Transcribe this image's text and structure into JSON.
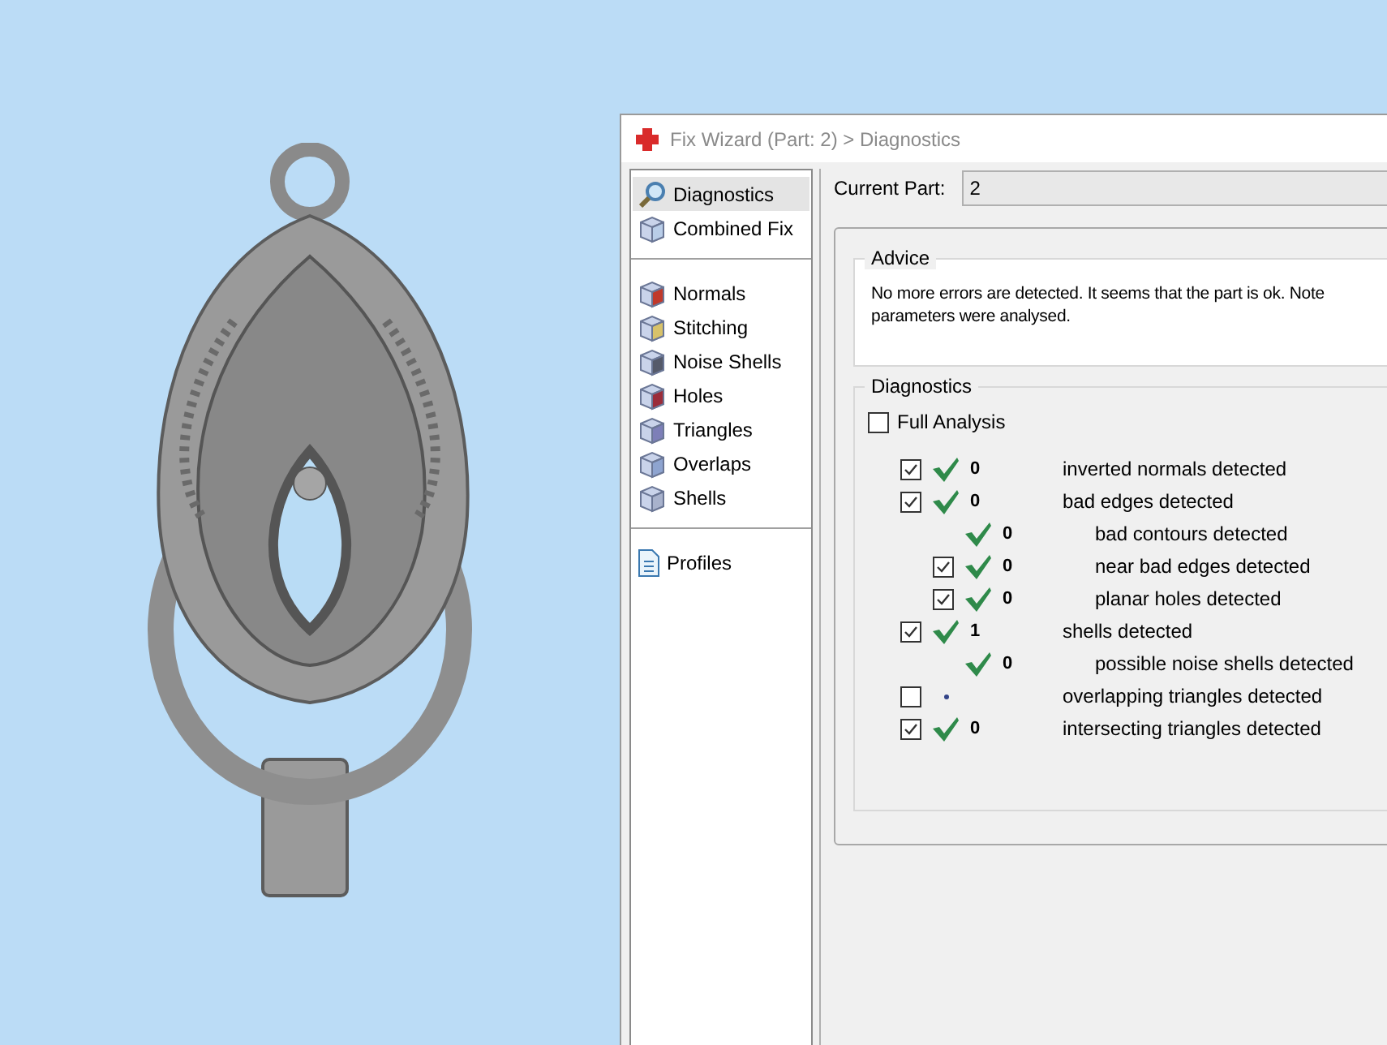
{
  "window": {
    "title": "Fix Wizard (Part: 2) > Diagnostics"
  },
  "sidebar": {
    "groups": [
      {
        "items": [
          {
            "label": "Diagnostics",
            "selected": true
          },
          {
            "label": "Combined Fix",
            "selected": false
          }
        ]
      },
      {
        "items": [
          {
            "label": "Normals",
            "selected": false
          },
          {
            "label": "Stitching",
            "selected": false
          },
          {
            "label": "Noise Shells",
            "selected": false
          },
          {
            "label": "Holes",
            "selected": false
          },
          {
            "label": "Triangles",
            "selected": false
          },
          {
            "label": "Overlaps",
            "selected": false
          },
          {
            "label": "Shells",
            "selected": false
          }
        ]
      },
      {
        "items": [
          {
            "label": "Profiles",
            "selected": false
          }
        ]
      }
    ]
  },
  "current_part": {
    "label": "Current Part:",
    "value": "2"
  },
  "advice": {
    "title": "Advice",
    "text_lines": [
      "No more errors are detected. It seems that the part is ok. Note",
      "parameters were analysed."
    ]
  },
  "diagnostics": {
    "title": "Diagnostics",
    "full_analysis": {
      "label": "Full Analysis",
      "checked": false
    },
    "rows": [
      {
        "kind": "checkbox",
        "checked": true,
        "passed": true,
        "value": "0",
        "label": "inverted normals detected"
      },
      {
        "kind": "checkbox",
        "checked": true,
        "passed": true,
        "value": "0",
        "label": "bad edges detected",
        "children": [
          {
            "kind": "plain",
            "passed": true,
            "value": "0",
            "label": "bad contours detected"
          },
          {
            "kind": "checkbox",
            "checked": true,
            "passed": true,
            "value": "0",
            "label": "near bad edges detected"
          },
          {
            "kind": "checkbox",
            "checked": true,
            "passed": true,
            "value": "0",
            "label": "planar holes detected"
          }
        ]
      },
      {
        "kind": "checkbox",
        "checked": true,
        "passed": true,
        "value": "1",
        "label": "shells detected",
        "children": [
          {
            "kind": "plain",
            "passed": true,
            "value": "0",
            "label": "possible noise shells detected"
          }
        ]
      },
      {
        "kind": "checkbox",
        "checked": false,
        "passed": false,
        "label": "overlapping triangles detected"
      },
      {
        "kind": "checkbox",
        "checked": true,
        "passed": true,
        "value": "0",
        "label": "intersecting triangles detected"
      }
    ]
  }
}
